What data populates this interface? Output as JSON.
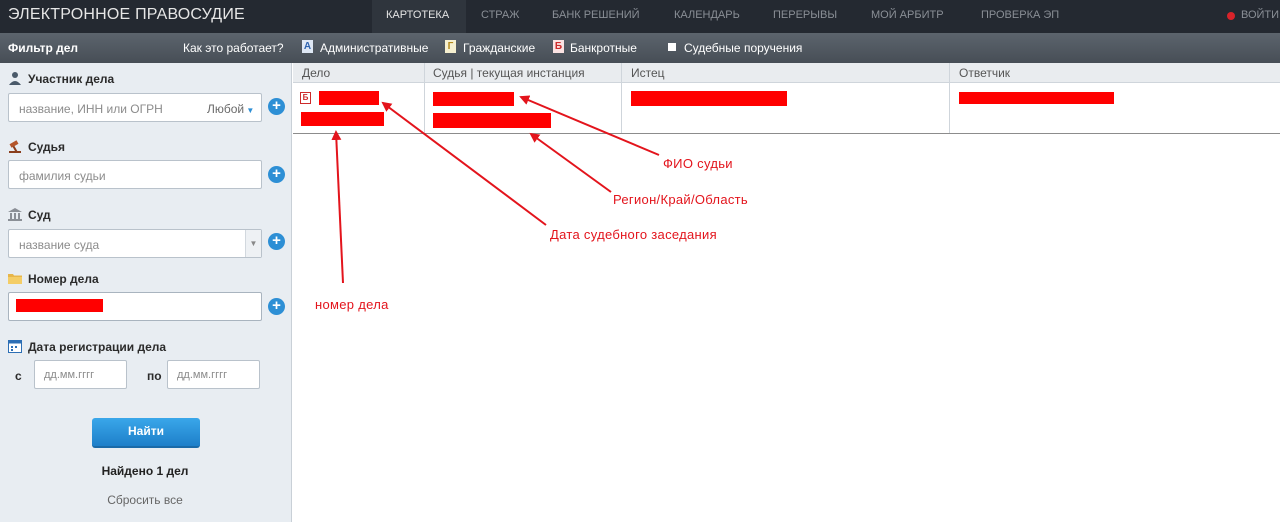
{
  "header": {
    "brand": "ЭЛЕКТРОННОЕ ПРАВОСУДИЕ",
    "nav": [
      "КАРТОТЕКА",
      "СТРАЖ",
      "БАНК РЕШЕНИЙ",
      "КАЛЕНДАРЬ",
      "ПЕРЕРЫВЫ",
      "МОЙ АРБИТР",
      "ПРОВЕРКА ЭП"
    ],
    "active_nav": "КАРТОТЕКА",
    "login": "ВОЙТИ"
  },
  "subbar": {
    "filter_title": "Фильтр дел",
    "how_link": "Как это работает?",
    "categories": [
      {
        "letter": "А",
        "label": "Административные"
      },
      {
        "letter": "Г",
        "label": "Гражданские"
      },
      {
        "letter": "Б",
        "label": "Банкротные"
      },
      {
        "letter": "",
        "label": "Судебные поручения"
      }
    ]
  },
  "sidebar": {
    "participant_label": "Участник дела",
    "participant_placeholder": "название, ИНН или ОГРН",
    "participant_type": "Любой",
    "judge_label": "Судья",
    "judge_placeholder": "фамилия судьи",
    "court_label": "Суд",
    "court_placeholder": "название суда",
    "case_number_label": "Номер дела",
    "date_label": "Дата регистрации дела",
    "date_from": "с",
    "date_to": "по",
    "date_placeholder": "дд.мм.гггг",
    "find_button": "Найти",
    "found_text": "Найдено 1 дел",
    "reset_text": "Сбросить все"
  },
  "table": {
    "columns": [
      "Дело",
      "Судья | текущая инстанция",
      "Истец",
      "Ответчик"
    ],
    "case_badge": "Б"
  },
  "annotations": {
    "judge_name": "ФИО судьи",
    "region": "Регион/Край/Область",
    "hearing_date": "Дата судебного заседания",
    "case_number": "номер дела"
  },
  "colors": {
    "redaction": "#ff0000",
    "annotation": "#e3141c",
    "accent": "#2d8fd5"
  }
}
